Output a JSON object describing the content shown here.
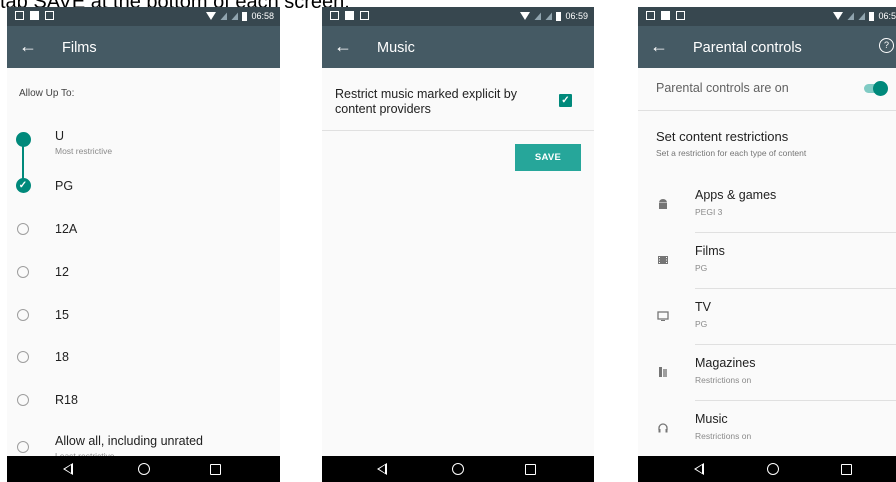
{
  "caption": "tap SAVE at the bottom of each screen.",
  "screens": {
    "films": {
      "time": "06:58",
      "title": "Films",
      "allow_label": "Allow Up To:",
      "options": [
        {
          "label": "U",
          "sub": "Most restrictive",
          "state": "filled"
        },
        {
          "label": "PG",
          "sub": "",
          "state": "checked"
        },
        {
          "label": "12A",
          "sub": "",
          "state": "empty"
        },
        {
          "label": "12",
          "sub": "",
          "state": "empty"
        },
        {
          "label": "15",
          "sub": "",
          "state": "empty"
        },
        {
          "label": "18",
          "sub": "",
          "state": "empty"
        },
        {
          "label": "R18",
          "sub": "",
          "state": "empty"
        },
        {
          "label": "Allow all, including unrated",
          "sub": "Least restrictive",
          "state": "empty"
        }
      ]
    },
    "music": {
      "time": "06:59",
      "title": "Music",
      "restrict_text": "Restrict music marked explicit by content providers",
      "checked": true,
      "save_label": "SAVE"
    },
    "parental": {
      "time": "06:5",
      "title": "Parental controls",
      "status": "Parental controls are on",
      "toggle_on": true,
      "set_title": "Set content restrictions",
      "set_sub": "Set a restriction for each type of content",
      "categories": [
        {
          "icon": "android-icon",
          "title": "Apps & games",
          "sub": "PEGI 3"
        },
        {
          "icon": "film-icon",
          "title": "Films",
          "sub": "PG"
        },
        {
          "icon": "tv-icon",
          "title": "TV",
          "sub": "PG"
        },
        {
          "icon": "book-icon",
          "title": "Magazines",
          "sub": "Restrictions on"
        },
        {
          "icon": "headphones-icon",
          "title": "Music",
          "sub": "Restrictions on"
        }
      ]
    }
  },
  "colors": {
    "appbar": "#455a64",
    "statusbar": "#37474f",
    "accent": "#00897b",
    "button": "#26a69a"
  }
}
